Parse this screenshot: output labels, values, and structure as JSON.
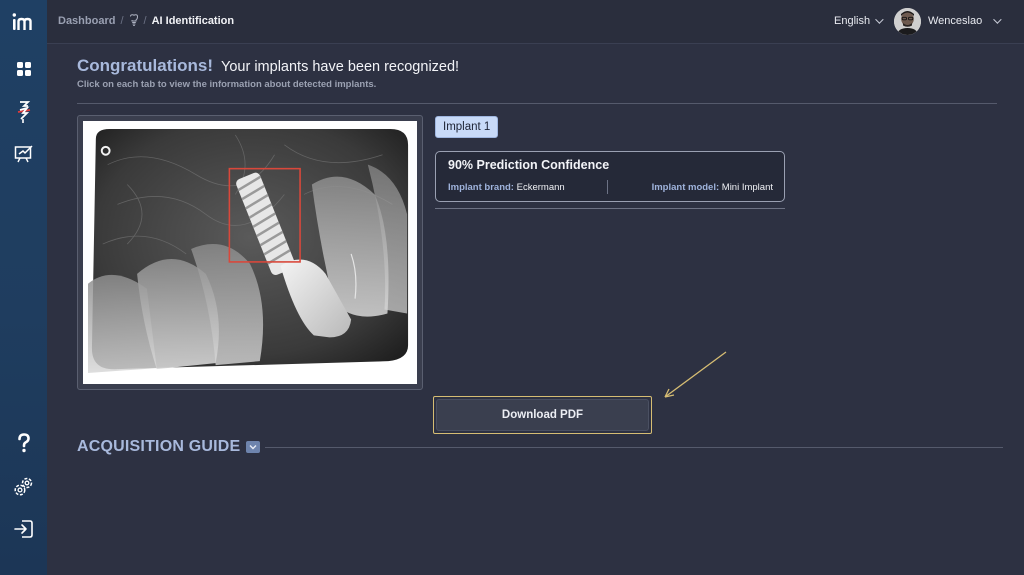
{
  "sidebar": {
    "logo": "im",
    "items": [
      "grid-icon",
      "implant-scan-icon",
      "board-icon"
    ],
    "bottom": [
      "help-icon",
      "gear-icon",
      "logout-icon"
    ]
  },
  "topbar": {
    "breadcrumb": {
      "home": "Dashboard",
      "sep": "/",
      "icon": "tooth-icon",
      "current": "AI Identification"
    },
    "language": "English",
    "username": "Wenceslao"
  },
  "heading": {
    "strong": "Congratulations!",
    "rest": "Your implants have been recognized!",
    "subtitle": "Click on each tab to view the information about detected implants."
  },
  "implant_tab": {
    "label": "Implant 1"
  },
  "result": {
    "title": "90% Prediction Confidence",
    "brand_key": "Implant brand:",
    "brand_value": "Eckermann",
    "model_key": "Implant model:",
    "model_value": "Mini Implant"
  },
  "download": {
    "label": "Download PDF"
  },
  "acquisition": {
    "title": "ACQUISITION GUIDE"
  },
  "colors": {
    "accent": "#a8b9dc",
    "highlight": "#d6bd73",
    "sidebar": "#1f4064",
    "background": "#2d3142"
  }
}
